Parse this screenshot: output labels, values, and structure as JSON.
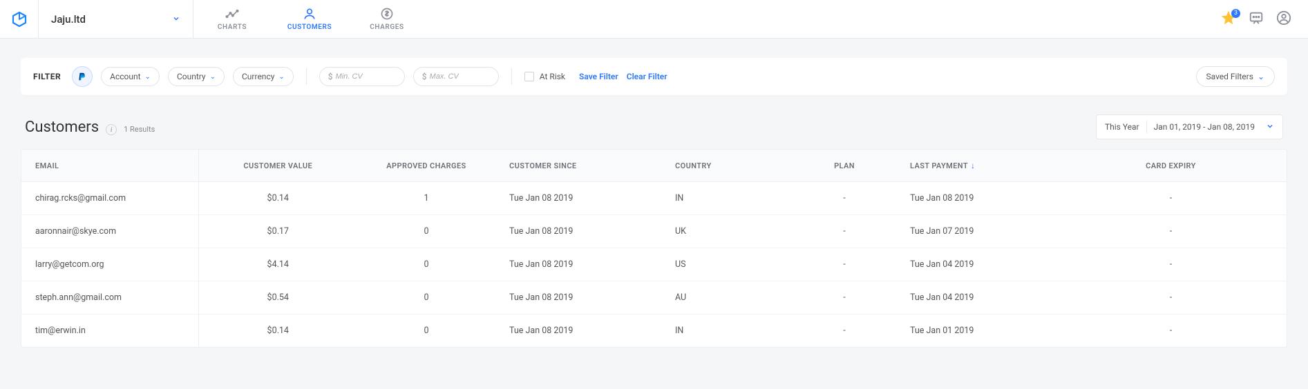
{
  "header": {
    "workspace": "Jaju.ltd",
    "tabs": [
      {
        "id": "charts",
        "label": "CHARTS"
      },
      {
        "id": "customers",
        "label": "CUSTOMERS"
      },
      {
        "id": "charges",
        "label": "CHARGES"
      }
    ],
    "star_badge": "3"
  },
  "filter": {
    "label": "FILTER",
    "pills": {
      "account": "Account",
      "country": "Country",
      "currency": "Currency"
    },
    "min_cv_placeholder": "Min. CV",
    "max_cv_placeholder": "Max. CV",
    "at_risk": "At Risk",
    "save_filter": "Save Filter",
    "clear_filter": "Clear Filter",
    "saved_filters": "Saved Filters"
  },
  "page": {
    "title": "Customers",
    "results": "1 Results",
    "range_label": "This Year",
    "range_value": "Jan 01, 2019 - Jan 08, 2019"
  },
  "table": {
    "columns": {
      "email": "EMAIL",
      "value": "CUSTOMER VALUE",
      "approved": "APPROVED CHARGES",
      "since": "CUSTOMER SINCE",
      "country": "COUNTRY",
      "plan": "PLAN",
      "last": "LAST PAYMENT",
      "expiry": "CARD EXPIRY"
    },
    "rows": [
      {
        "email": "chirag.rcks@gmail.com",
        "value": "$0.14",
        "approved": "1",
        "since": "Tue Jan 08 2019",
        "country": "IN",
        "plan": "-",
        "last": "Tue Jan 08 2019",
        "expiry": "-"
      },
      {
        "email": "aaronnair@skye.com",
        "value": "$0.17",
        "approved": "0",
        "since": "Tue Jan 08 2019",
        "country": "UK",
        "plan": "-",
        "last": "Tue Jan 07 2019",
        "expiry": "-"
      },
      {
        "email": "larry@getcom.org",
        "value": "$4.14",
        "approved": "0",
        "since": "Tue Jan 08 2019",
        "country": "US",
        "plan": "-",
        "last": "Tue Jan 04 2019",
        "expiry": "-"
      },
      {
        "email": "steph.ann@gmail.com",
        "value": "$0.54",
        "approved": "0",
        "since": "Tue Jan 08 2019",
        "country": "AU",
        "plan": "-",
        "last": "Tue Jan 04 2019",
        "expiry": "-"
      },
      {
        "email": "tim@erwin.in",
        "value": "$0.14",
        "approved": "0",
        "since": "Tue Jan 08 2019",
        "country": "IN",
        "plan": "-",
        "last": "Tue Jan 01 2019",
        "expiry": "-"
      }
    ]
  }
}
